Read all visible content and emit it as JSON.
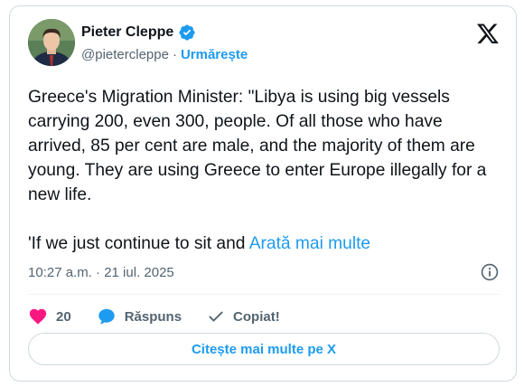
{
  "author": {
    "name": "Pieter Cleppe",
    "handle": "@pietercleppe",
    "separator": "·",
    "follow_label": "Urmărește"
  },
  "tweet": {
    "text": "Greece's Migration Minister: \"Libya is using big vessels carrying 200, even 300, people. Of all those who have arrived, 85 per cent are male, and the majority of them are young. They are using Greece to enter Europe illegally for a new life.\n\n'If we just continue to sit and ",
    "show_more_label": "Arată mai multe",
    "timestamp": "10:27 a.m. · 21 iul. 2025"
  },
  "actions": {
    "likes_count": "20",
    "reply_label": "Răspuns",
    "copy_label": "Copiat!"
  },
  "read_more_button": "Citește mai multe pe X",
  "colors": {
    "accent": "#1d9bf0",
    "heart": "#f91880",
    "text": "#0f1419",
    "secondary": "#536471"
  },
  "icons": [
    "verified-badge-icon",
    "x-logo-icon",
    "info-icon",
    "heart-icon",
    "reply-bubble-icon",
    "checkmark-icon"
  ]
}
